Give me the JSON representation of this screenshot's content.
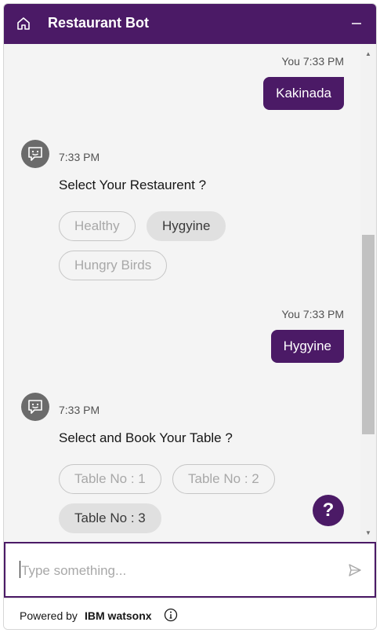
{
  "header": {
    "title": "Restaurant Bot",
    "home_icon": "home-icon",
    "minimize_icon": "minimize-icon"
  },
  "messages": [
    {
      "sender": "user",
      "meta": "You 7:33 PM",
      "text": "Kakinada"
    },
    {
      "sender": "bot",
      "time": "7:33 PM",
      "text": "Select Your Restaurent ?",
      "options": [
        {
          "label": "Healthy",
          "selected": false
        },
        {
          "label": "Hygyine",
          "selected": true
        },
        {
          "label": "Hungry Birds",
          "selected": false
        }
      ]
    },
    {
      "sender": "user",
      "meta": "You 7:33 PM",
      "text": "Hygyine"
    },
    {
      "sender": "bot",
      "time": "7:33 PM",
      "text": "Select and Book Your Table ?",
      "options": [
        {
          "label": "Table No : 1",
          "selected": false
        },
        {
          "label": "Table No : 2",
          "selected": false
        },
        {
          "label": "Table No : 3",
          "selected": true
        }
      ]
    }
  ],
  "help_button": {
    "label": "?"
  },
  "input": {
    "placeholder": "Type something..."
  },
  "footer": {
    "powered_by": "Powered by",
    "brand": "IBM watsonx"
  },
  "colors": {
    "brand": "#4b1a66",
    "chat_background": "#f4f4f4",
    "avatar": "#6b6b6b"
  }
}
